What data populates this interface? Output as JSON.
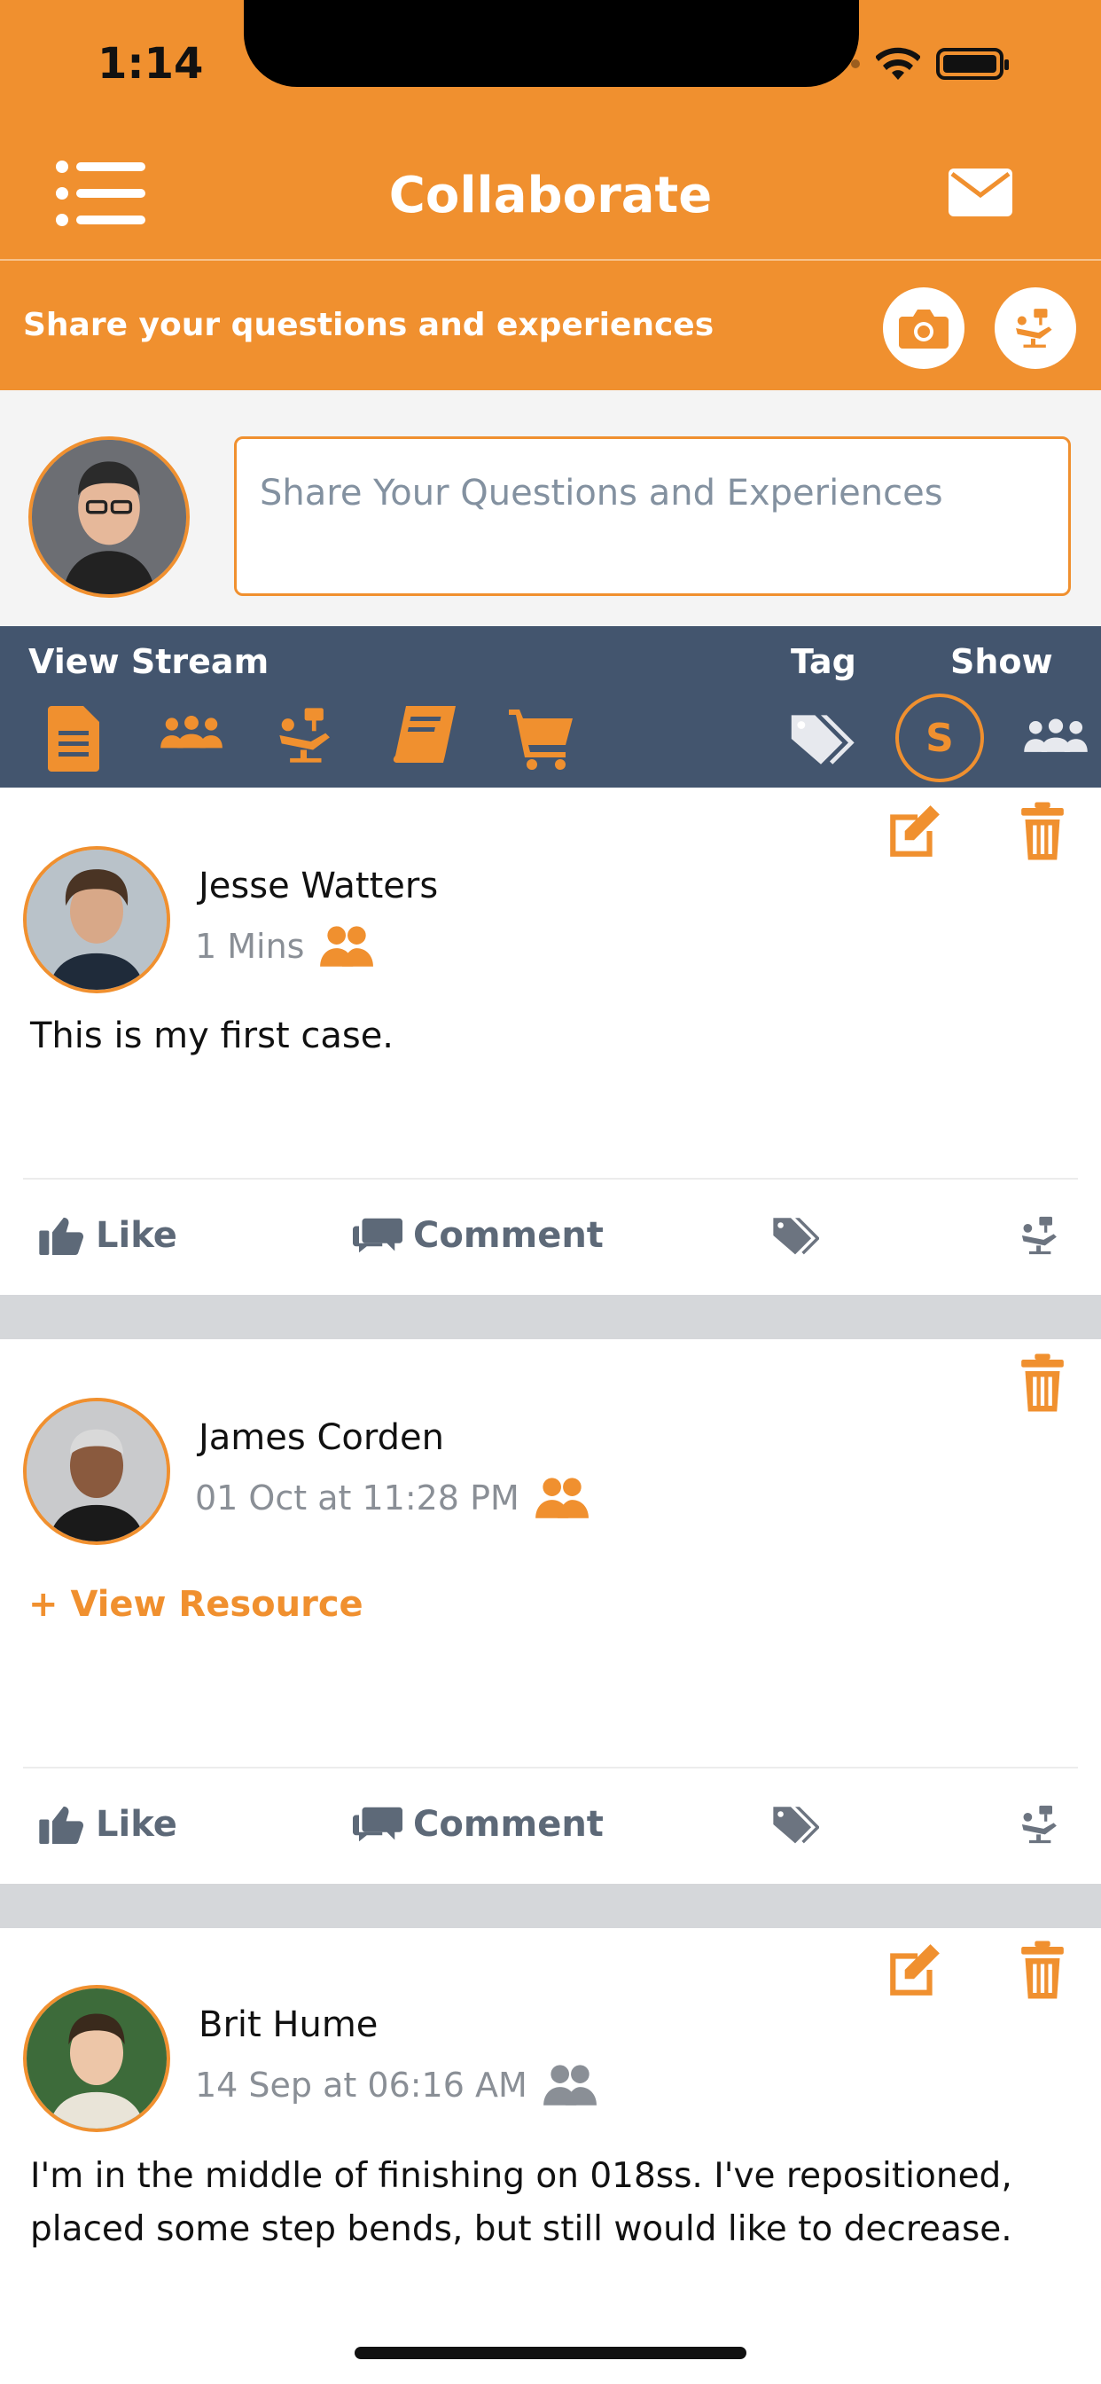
{
  "status_bar": {
    "time": "1:14"
  },
  "header": {
    "title": "Collaborate"
  },
  "share_bar": {
    "text": "Share your questions and experiences"
  },
  "composer": {
    "placeholder": "Share Your Questions and Experiences"
  },
  "filter_bar": {
    "view_stream_label": "View Stream",
    "tag_label": "Tag",
    "show_label": "Show",
    "show_badge": "S"
  },
  "colors": {
    "accent": "#F0902F",
    "filter_bg": "#43556e",
    "meta_gray": "#8a8f96"
  },
  "posts": [
    {
      "author": "Jesse Watters",
      "time": "1 Mins",
      "body": "This is my first case.",
      "like_label": "Like",
      "comment_label": "Comment"
    },
    {
      "author": "James Corden",
      "time": "01 Oct at 11:28 PM",
      "link": "+ View Resource",
      "like_label": "Like",
      "comment_label": "Comment"
    },
    {
      "author": "Brit Hume",
      "time": "14 Sep at 06:16 AM",
      "body_line1": "I'm in the middle of finishing on 018ss. I've repositioned,",
      "body_line2": "placed some step bends, but still would like to decrease."
    }
  ]
}
